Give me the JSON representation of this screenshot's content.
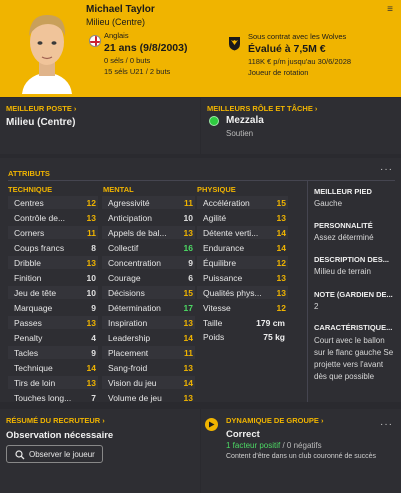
{
  "header": {
    "name": "Michael Taylor",
    "position": "Milieu (Centre)",
    "nationality": "Anglais",
    "age": "21 ans (9/8/2003)",
    "caps_senior": "0 séls / 0 buts",
    "caps_u21": "15 séls U21 / 2 buts",
    "contract": "Sous contrat avec les Wolves",
    "value": "Évalué à 7,5M €",
    "wage": "118K € p/m jusqu'au 30/6/2028",
    "squad_role": "Joueur de rotation",
    "menu": "≡"
  },
  "best_position": {
    "title": "MEILLEUR POSTE ›",
    "value": "Milieu (Centre)"
  },
  "best_role": {
    "title": "MEILLEURS RÔLE ET TÂCHE ›",
    "role": "Mezzala",
    "duty": "Soutien"
  },
  "attributes": {
    "title": "ATTRIBUTS",
    "technical_header": "TECHNIQUE",
    "mental_header": "MENTAL",
    "physical_header": "PHYSIQUE",
    "technical": [
      {
        "name": "Centres",
        "value": "12"
      },
      {
        "name": "Contrôle de...",
        "value": "13"
      },
      {
        "name": "Corners",
        "value": "11"
      },
      {
        "name": "Coups francs",
        "value": "8"
      },
      {
        "name": "Dribble",
        "value": "13"
      },
      {
        "name": "Finition",
        "value": "10"
      },
      {
        "name": "Jeu de tête",
        "value": "10"
      },
      {
        "name": "Marquage",
        "value": "9"
      },
      {
        "name": "Passes",
        "value": "13"
      },
      {
        "name": "Penalty",
        "value": "4"
      },
      {
        "name": "Tacles",
        "value": "9"
      },
      {
        "name": "Technique",
        "value": "14"
      },
      {
        "name": "Tirs de loin",
        "value": "13"
      },
      {
        "name": "Touches long...",
        "value": "7"
      }
    ],
    "mental": [
      {
        "name": "Agressivité",
        "value": "11"
      },
      {
        "name": "Anticipation",
        "value": "10"
      },
      {
        "name": "Appels de bal...",
        "value": "13"
      },
      {
        "name": "Collectif",
        "value": "16"
      },
      {
        "name": "Concentration",
        "value": "9"
      },
      {
        "name": "Courage",
        "value": "6"
      },
      {
        "name": "Décisions",
        "value": "15"
      },
      {
        "name": "Détermination",
        "value": "17"
      },
      {
        "name": "Inspiration",
        "value": "13"
      },
      {
        "name": "Leadership",
        "value": "14"
      },
      {
        "name": "Placement",
        "value": "11"
      },
      {
        "name": "Sang-froid",
        "value": "13"
      },
      {
        "name": "Vision du jeu",
        "value": "14"
      },
      {
        "name": "Volume de jeu",
        "value": "13"
      }
    ],
    "physical": [
      {
        "name": "Accélération",
        "value": "15"
      },
      {
        "name": "Agilité",
        "value": "13"
      },
      {
        "name": "Détente verti...",
        "value": "14"
      },
      {
        "name": "Endurance",
        "value": "14"
      },
      {
        "name": "Équilibre",
        "value": "12"
      },
      {
        "name": "Puissance",
        "value": "13"
      },
      {
        "name": "Qualités phys...",
        "value": "13"
      },
      {
        "name": "Vitesse",
        "value": "12"
      }
    ],
    "height_label": "Taille",
    "height": "179 cm",
    "weight_label": "Poids",
    "weight": "75 kg"
  },
  "side": {
    "foot_label": "MEILLEUR PIED",
    "foot": "Gauche",
    "personality_label": "PERSONNALITÉ",
    "personality": "Assez déterminé",
    "description_label": "DESCRIPTION DES...",
    "description": "Milieu de terrain",
    "rating_label": "NOTE (GARDIEN DE...",
    "rating": "2",
    "traits_label": "CARACTÉRISTIQUE...",
    "traits": "Court avec le ballon sur le flanc gauche Se projette vers l'avant dès que possible"
  },
  "scout": {
    "title": "RÉSUMÉ DU RECRUTEUR ›",
    "value": "Observation nécessaire",
    "button": "Observer le joueur"
  },
  "dynamics": {
    "title": "DYNAMIQUE DE GROUPE ›",
    "value": "Correct",
    "positive": "1 facteur positif",
    "separator": " / ",
    "negative": "0 négatifs",
    "note": "Content d'être dans un club couronné de succès"
  },
  "dots": "···",
  "colors": {
    "accent": "#f0b400",
    "high": "#4cd964",
    "mid": "#f0b400",
    "low": "#e0e0e0",
    "bg": "#2a2a2f"
  }
}
